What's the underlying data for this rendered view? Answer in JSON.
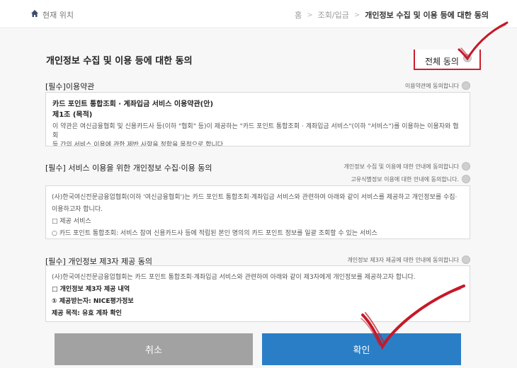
{
  "header": {
    "location_label": "현재 위치",
    "breadcrumb": [
      "홈",
      "조회/입금",
      "개인정보 수집 및 이용 등에 대한 동의"
    ]
  },
  "page": {
    "title": "개인정보 수집 및 이용 등에 대한 동의",
    "all_agree_label": "전체 동의"
  },
  "sections": {
    "terms": {
      "title": "[필수]이용약관",
      "note": "이용약관에 동의합니다",
      "lines": [
        "카드 포인트 통합조회 · 계좌입금 서비스 이용약관(안)",
        "제1조 (목적)",
        "이 약관은 여신금융협회 및 신용카드사 등(이하 \"협회\" 등)이 제공하는 \"카드 포인트 통합조회 · 계좌입금 서비스\"(이하 \"서비스\")를 이용하는 이용자와 협회",
        "등 간의 서비스 이용에 관한 제반 사항을 정함을 목적으로 합니다."
      ]
    },
    "privacy": {
      "title": "[필수] 서비스 이용을 위한 개인정보 수집·이용 동의",
      "note1": "개인정보 수집 및 이용에 대한 안내에 동의합니다",
      "note2": "고유식별정보 이용에 대한 안내에 동의합니다.",
      "lines": [
        "(사)한국여신전문금융업협회(이하 '여신금융협회')는 카드 포인트 통합조회·계좌입금 서비스와 관련하여 아래와 같이 서비스를 제공하고 개인정보를 수집·",
        "이용하고자 합니다.",
        "□ 제공 서비스",
        "○ 카드 포인트 통합조회: 서비스 참여 신용카드사 등에 적립된 본인 명의의 카드 포인트 정보를 일괄 조회할 수 있는 서비스"
      ]
    },
    "third_party": {
      "title": "[필수] 개인정보 제3자 제공 동의",
      "note": "개인정보 제3자 제공에 대한 안내에 동의합니다",
      "lines": [
        "(사)한국여신전문금융업협회는 카드 포인트 통합조회·계좌입금 서비스와 관련하여 아래와 같이 제3자에게 개인정보를 제공하고자 합니다.",
        "□ 개인정보 제3자 제공 내역",
        "① 제공받는자: NICE평가정보",
        "제공 목적: 유효 계좌 확인"
      ]
    }
  },
  "buttons": {
    "cancel": "취소",
    "confirm": "확인"
  },
  "colors": {
    "accent_red": "#cc1f2f",
    "confirm_blue": "#2a7ec6",
    "cancel_gray": "#a2a2a2"
  }
}
